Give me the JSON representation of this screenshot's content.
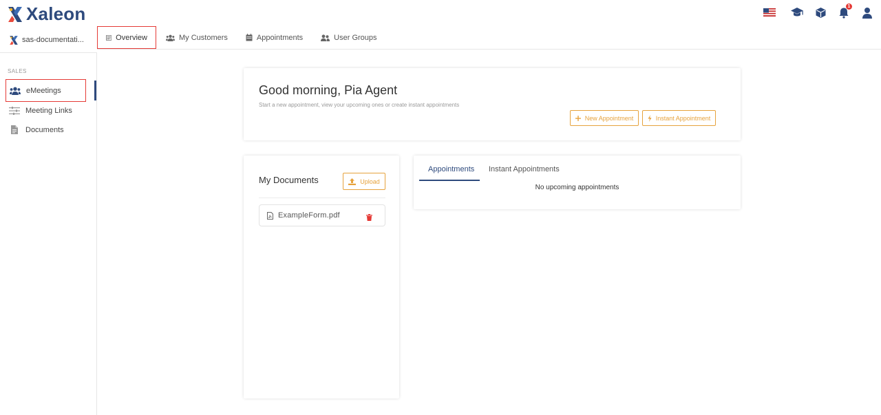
{
  "brand": {
    "name": "Xaleon",
    "accent": "#2e4a7d",
    "warning": "#e6a23c",
    "danger": "#e53935"
  },
  "topbar": {
    "icons": [
      "us-flag-icon",
      "graduation-cap-icon",
      "cube-icon",
      "bell-icon",
      "user-icon"
    ],
    "notification_count": "1"
  },
  "workspace": {
    "name": "sas-documentati..."
  },
  "nav": {
    "tabs": [
      {
        "label": "Overview",
        "icon": "overview-icon"
      },
      {
        "label": "My Customers",
        "icon": "users-icon"
      },
      {
        "label": "Appointments",
        "icon": "calendar-icon"
      },
      {
        "label": "User Groups",
        "icon": "user-groups-icon"
      }
    ]
  },
  "sidebar": {
    "section": "SALES",
    "items": [
      {
        "label": "eMeetings",
        "icon": "people-icon"
      },
      {
        "label": "Meeting Links",
        "icon": "sliders-icon"
      },
      {
        "label": "Documents",
        "icon": "document-icon"
      }
    ]
  },
  "welcome": {
    "title": "Good morning, Pia Agent",
    "subtitle": "Start a new appointment, view your upcoming ones or create instant appointments",
    "new_appointment": "New Appointment",
    "instant_appointment": "Instant Appointment"
  },
  "documents": {
    "title": "My Documents",
    "upload": "Upload",
    "files": [
      {
        "name": "ExampleForm.pdf"
      }
    ]
  },
  "appointments_panel": {
    "tabs": [
      "Appointments",
      "Instant Appointments"
    ],
    "empty": "No upcoming appointments"
  }
}
